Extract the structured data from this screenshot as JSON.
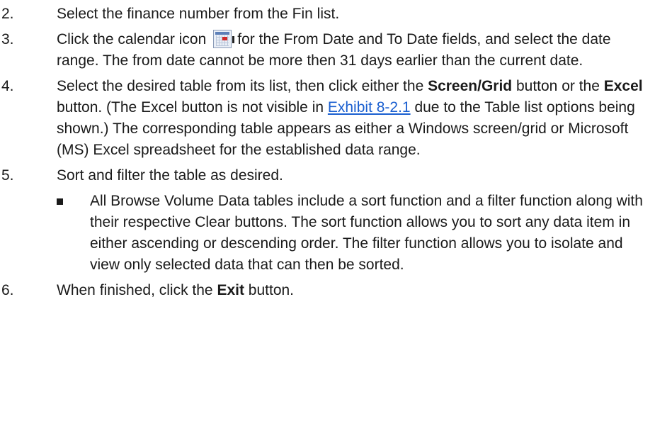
{
  "steps": [
    {
      "num": "2.",
      "text": "Select the finance number from the Fin list."
    },
    {
      "num": "3.",
      "pre": "Click the calendar icon",
      "post": "for the From Date and To Date fields, and select the date range. The from date cannot be more then 31 days earlier than the current date."
    },
    {
      "num": "4.",
      "t1": "Select the desired table from its list, then click either the ",
      "b1": "Screen/Grid",
      "t2": " button or the ",
      "b2": "Excel",
      "t3": " button. (The Excel button is not visible in ",
      "link": "Exhibit 8-2.1",
      "t4": " due to the Table list options being shown.) The corresponding table appears as either a Windows screen/grid or Microsoft (MS) Excel spreadsheet for the established data range."
    },
    {
      "num": "5.",
      "text": "Sort and filter the table as desired.",
      "bullet": "All Browse Volume Data tables include a sort function and a filter function along with their respective Clear buttons. The sort function allows you to sort any data item in either ascending or descending order. The filter function allows you to isolate and view only selected data that can then be sorted."
    },
    {
      "num": "6.",
      "t1": "When finished, click the ",
      "b1": "Exit",
      "t2": " button."
    }
  ],
  "icons": {
    "calendar": "calendar-icon"
  }
}
